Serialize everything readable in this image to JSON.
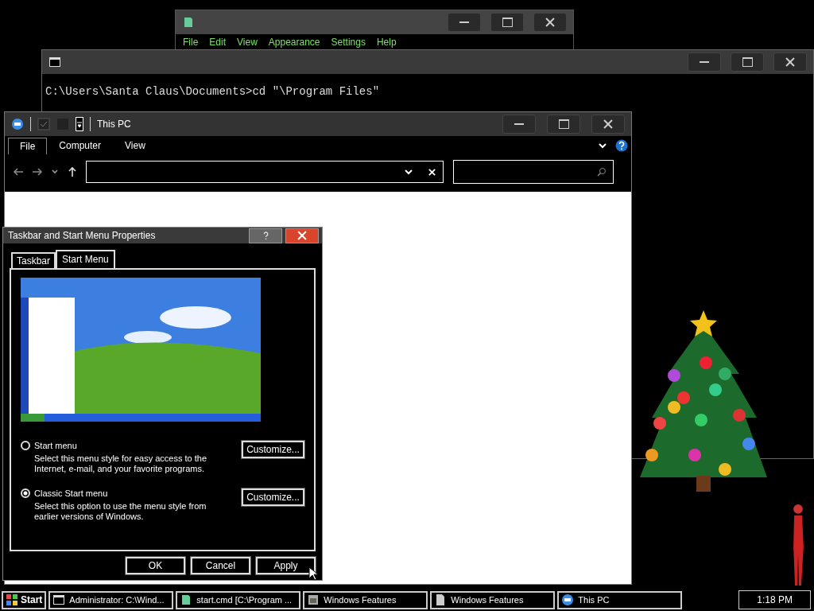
{
  "notepad_window": {
    "menu": [
      "File",
      "Edit",
      "View",
      "Appearance",
      "Settings",
      "Help"
    ]
  },
  "console_window": {
    "lines": [
      "C:\\Users\\Santa Claus\\Documents>cd \"\\Program Files\""
    ]
  },
  "explorer_window": {
    "title": "This PC",
    "ribbon_tabs": [
      {
        "label": "File",
        "selected": true
      },
      {
        "label": "Computer",
        "selected": false
      },
      {
        "label": "View",
        "selected": false
      }
    ]
  },
  "dialog": {
    "title": "Taskbar and Start Menu Properties",
    "tabs": [
      {
        "label": "Taskbar",
        "selected": false
      },
      {
        "label": "Start Menu",
        "selected": true
      }
    ],
    "options": [
      {
        "label": "Start menu",
        "description": "Select this menu style for easy access to the Internet, e-mail, and your favorite programs.",
        "selected": false,
        "button": "Customize..."
      },
      {
        "label": "Classic Start menu",
        "description": "Select this option to use the menu style from earlier versions of Windows.",
        "selected": true,
        "button": "Customize..."
      }
    ],
    "buttons": [
      "OK",
      "Cancel",
      "Apply"
    ]
  },
  "taskbar": {
    "start": "Start",
    "buttons": [
      {
        "label": "Administrator: C:\\Wind...",
        "kind": "console"
      },
      {
        "label": "start.cmd [C:\\Program ...",
        "kind": "notepad"
      },
      {
        "label": "Windows Features",
        "kind": "features"
      },
      {
        "label": "Windows Features",
        "kind": "document"
      },
      {
        "label": "This PC",
        "kind": "computer"
      }
    ],
    "clock": "1:18 PM"
  }
}
